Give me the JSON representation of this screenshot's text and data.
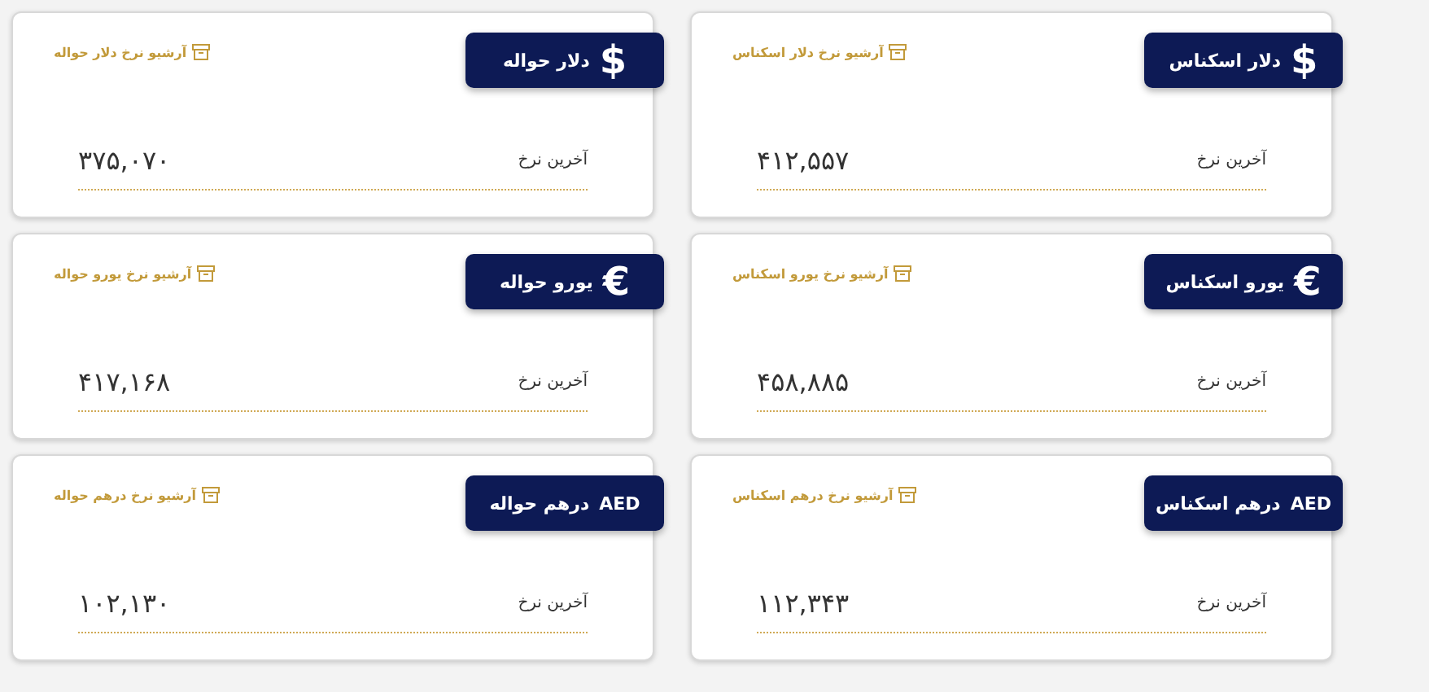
{
  "cards": [
    {
      "title": "دلار اسکناس",
      "symbol": "$",
      "archive_link": "آرشیو نرخ دلار اسکناس",
      "rate_label": "آخرین نرخ",
      "rate": "۴۱۲,۵۵۷"
    },
    {
      "title": "دلار حواله",
      "symbol": "$",
      "archive_link": "آرشیو نرخ دلار حواله",
      "rate_label": "آخرین نرخ",
      "rate": "۳۷۵,۰۷۰"
    },
    {
      "title": "یورو اسکناس",
      "symbol": "€",
      "archive_link": "آرشیو نرخ یورو اسکناس",
      "rate_label": "آخرین نرخ",
      "rate": "۴۵۸,۸۸۵"
    },
    {
      "title": "یورو حواله",
      "symbol": "€",
      "archive_link": "آرشیو نرخ یورو حواله",
      "rate_label": "آخرین نرخ",
      "rate": "۴۱۷,۱۶۸"
    },
    {
      "title": "درهم اسکناس",
      "symbol": "AED",
      "archive_link": "آرشیو نرخ درهم اسکناس",
      "rate_label": "آخرین نرخ",
      "rate": "۱۱۲,۳۴۳"
    },
    {
      "title": "درهم حواله",
      "symbol": "AED",
      "archive_link": "آرشیو نرخ درهم حواله",
      "rate_label": "آخرین نرخ",
      "rate": "۱۰۲,۱۳۰"
    }
  ]
}
